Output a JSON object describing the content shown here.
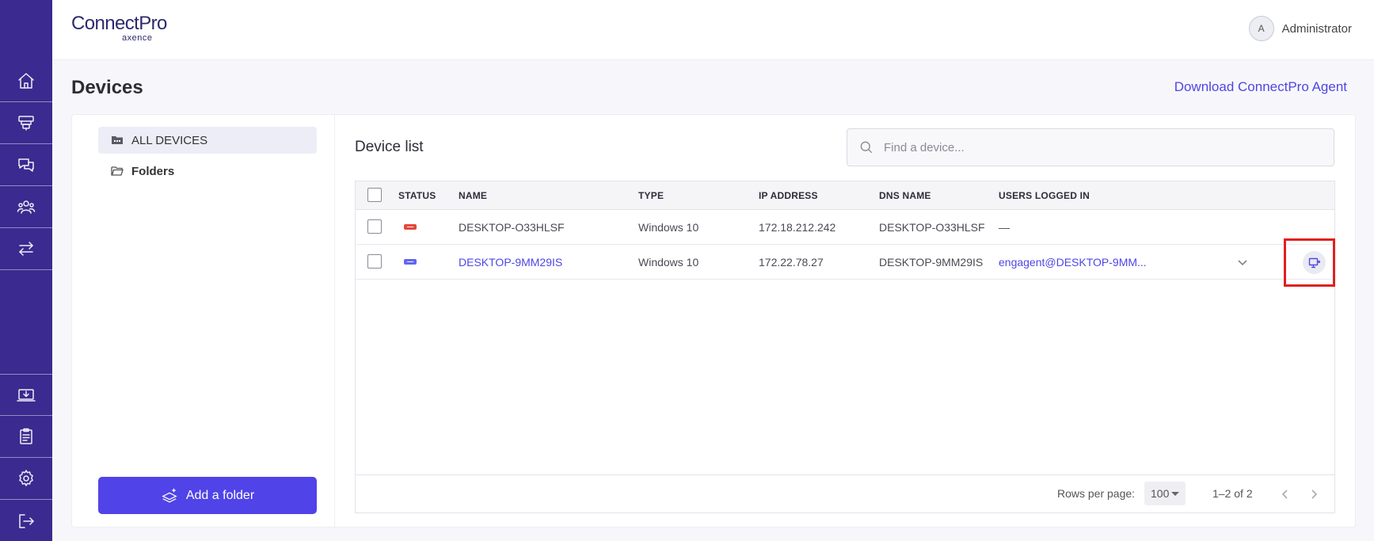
{
  "nav": {
    "items": [
      {
        "icon": "home-icon"
      },
      {
        "icon": "devices-icon"
      },
      {
        "icon": "chat-icon"
      },
      {
        "icon": "users-icon"
      },
      {
        "icon": "transfer-icon"
      },
      {
        "icon": "download-icon"
      },
      {
        "icon": "clipboard-icon"
      },
      {
        "icon": "gear-icon"
      },
      {
        "icon": "logout-icon"
      }
    ],
    "color": "#3b2a8f"
  },
  "header": {
    "logo_main": "ConnectPro",
    "logo_sub": "axence",
    "user_initial": "A",
    "user_name": "Administrator"
  },
  "page": {
    "title": "Devices",
    "download_link": "Download ConnectPro Agent"
  },
  "tree": {
    "all_devices": "ALL DEVICES",
    "folders": "Folders",
    "add_folder": "Add a folder"
  },
  "device_list": {
    "title": "Device list",
    "search_placeholder": "Find a device...",
    "columns": {
      "status": "STATUS",
      "name": "NAME",
      "type": "TYPE",
      "ip": "IP ADDRESS",
      "dns": "DNS NAME",
      "users": "USERS LOGGED IN"
    },
    "rows": [
      {
        "status_color": "#e5483b",
        "name": "DESKTOP-O33HLSF",
        "type": "Windows 10",
        "ip": "172.18.212.242",
        "dns": "DESKTOP-O33HLSF",
        "users": "—"
      },
      {
        "status_color": "#6366f1",
        "name": "DESKTOP-9MM29IS",
        "type": "Windows 10",
        "ip": "172.22.78.27",
        "dns": "DESKTOP-9MM29IS",
        "users": "engagent@DESKTOP-9MM..."
      }
    ],
    "footer": {
      "rows_per_page_label": "Rows per page:",
      "rows_per_page_value": "100",
      "range": "1–2 of 2"
    }
  },
  "accent_color": "#4f46e5",
  "highlight_color": "#e02020"
}
